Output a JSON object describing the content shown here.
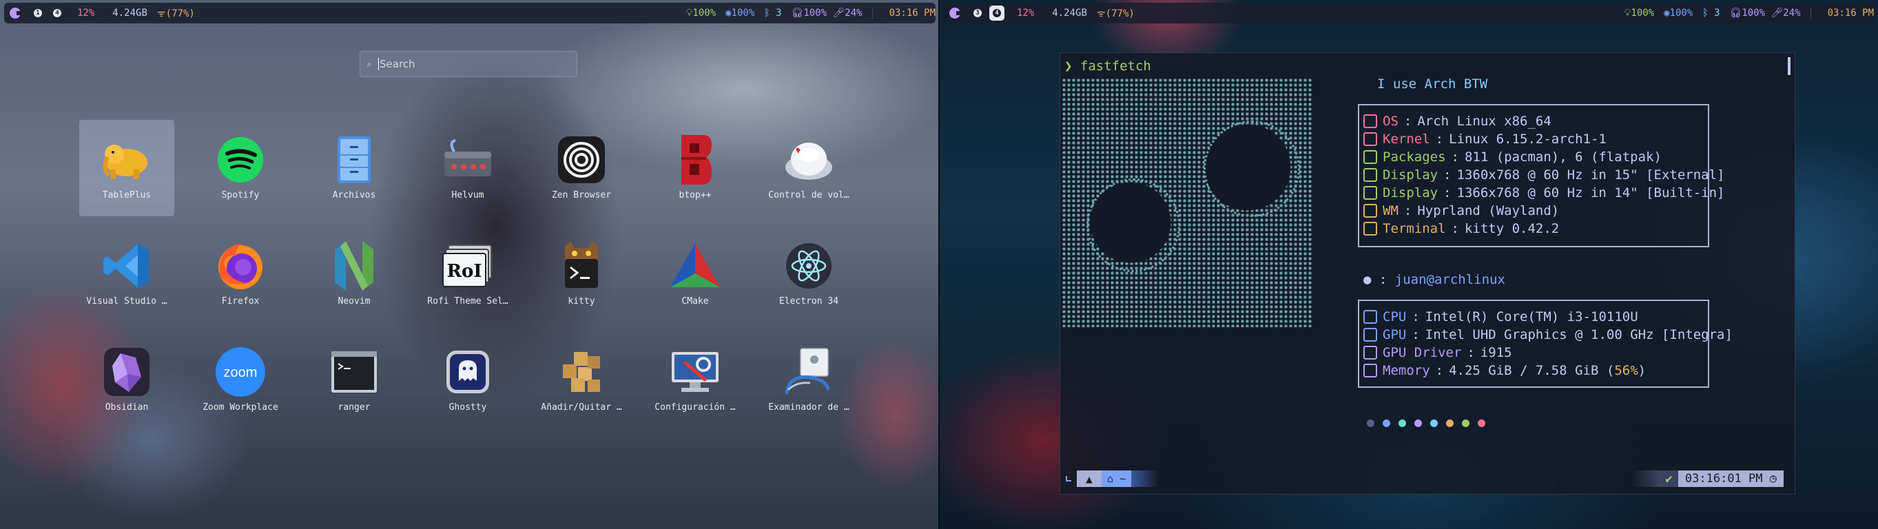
{
  "left_bar": {
    "workspaces": [
      {
        "label": "1",
        "active": false
      },
      {
        "label": "4",
        "active": false
      }
    ],
    "cpu": "12%",
    "ram": "4.24GB",
    "wifi": "(77%)",
    "brightness": "100%",
    "bluetooth_battery": "100%",
    "bluetooth_devices": "3",
    "headphones": "100%",
    "mic": "24%",
    "clock": "03:16 PM"
  },
  "right_bar": {
    "workspaces": [
      {
        "label": "3",
        "active": false
      },
      {
        "label": "4",
        "active": true
      }
    ],
    "cpu": "12%",
    "ram": "4.24GB",
    "wifi": "(77%)",
    "brightness": "100%",
    "bluetooth_battery": "100%",
    "bluetooth_devices": "3",
    "headphones": "100%",
    "mic": "24%",
    "clock": "03:16 PM"
  },
  "launcher": {
    "search_placeholder": "Search",
    "apps": [
      {
        "name": "TablePlus",
        "icon": "tableplus-icon"
      },
      {
        "name": "Spotify",
        "icon": "spotify-icon"
      },
      {
        "name": "Archivos",
        "icon": "files-icon"
      },
      {
        "name": "Helvum",
        "icon": "helvum-icon"
      },
      {
        "name": "Zen Browser",
        "icon": "zen-browser-icon"
      },
      {
        "name": "btop++",
        "icon": "btop-icon"
      },
      {
        "name": "Control de vol…",
        "icon": "volume-control-icon"
      },
      {
        "name": "Visual Studio …",
        "icon": "vscode-icon"
      },
      {
        "name": "Firefox",
        "icon": "firefox-icon"
      },
      {
        "name": "Neovim",
        "icon": "neovim-icon"
      },
      {
        "name": "Rofi Theme Sel…",
        "icon": "rofi-theme-icon"
      },
      {
        "name": "kitty",
        "icon": "kitty-icon"
      },
      {
        "name": "CMake",
        "icon": "cmake-icon"
      },
      {
        "name": "Electron 34",
        "icon": "electron-icon"
      },
      {
        "name": "Obsidian",
        "icon": "obsidian-icon"
      },
      {
        "name": "Zoom Workplace",
        "icon": "zoom-icon"
      },
      {
        "name": "ranger",
        "icon": "ranger-icon"
      },
      {
        "name": "Ghostty",
        "icon": "ghostty-icon"
      },
      {
        "name": "Añadir/Quitar …",
        "icon": "add-remove-software-icon"
      },
      {
        "name": "Configuración …",
        "icon": "settings-icon"
      },
      {
        "name": "Examinador de …",
        "icon": "image-viewer-icon"
      }
    ],
    "selected_app": "TablePlus",
    "zoom_icon_text": "zoom",
    "rofi_icon_text": "RoI"
  },
  "terminal": {
    "prompt_symbol": "❯",
    "command": "fastfetch",
    "title": "I use Arch BTW",
    "system_rows": [
      {
        "key": "OS",
        "value": "Arch Linux x86_64",
        "color": "#f7768e",
        "icon": "monitor-icon"
      },
      {
        "key": "Kernel",
        "value": "Linux 6.15.2-arch1-1",
        "color": "#f7768e",
        "icon": "kernel-icon"
      },
      {
        "key": "Packages",
        "value": "811 (pacman), 6 (flatpak)",
        "color": "#9ece6a",
        "icon": "package-icon"
      },
      {
        "key": "Display",
        "value": "1360x768 @ 60 Hz in 15\" [External]",
        "color": "#9ece6a",
        "icon": "display-icon"
      },
      {
        "key": "Display",
        "value": "1366x768 @ 60 Hz in 14\" [Built-in]",
        "color": "#9ece6a",
        "icon": "display-icon"
      },
      {
        "key": "WM",
        "value": "Hyprland (Wayland)",
        "color": "#e0af68",
        "icon": "wm-icon"
      },
      {
        "key": "Terminal",
        "value": "kitty 0.42.2",
        "color": "#e0af68",
        "icon": "terminal-icon"
      }
    ],
    "user_key": "",
    "user": "juan@archlinux",
    "hardware_rows": [
      {
        "key": "CPU",
        "value": "Intel(R) Core(TM) i3-10110U",
        "color": "#7aa2f7",
        "icon": "cpu-icon"
      },
      {
        "key": "GPU",
        "value": "Intel UHD Graphics @ 1.00 GHz [Integra]",
        "color": "#7aa2f7",
        "icon": "gpu-icon"
      },
      {
        "key": "GPU Driver",
        "value": "i915",
        "color": "#bb9af7",
        "icon": "driver-icon"
      },
      {
        "key": "Memory",
        "value": "4.25 GiB / 7.58 GiB (",
        "pct": "56%",
        "tail": ")",
        "color": "#bb9af7",
        "icon": "memory-icon"
      }
    ],
    "palette": [
      "#565f89",
      "#7aa2f7",
      "#73daca",
      "#bb9af7",
      "#7dcfff",
      "#e0af68",
      "#9ece6a",
      "#f7768e"
    ],
    "status_home": "~",
    "status_ok": "✔",
    "status_time": "03:16:01 PM"
  }
}
